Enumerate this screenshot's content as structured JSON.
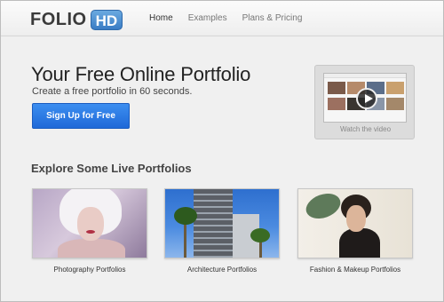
{
  "brand": {
    "name": "FOLIO",
    "badge": "HD"
  },
  "nav": [
    {
      "label": "Home",
      "active": true
    },
    {
      "label": "Examples",
      "active": false
    },
    {
      "label": "Plans & Pricing",
      "active": false
    }
  ],
  "hero": {
    "title": "Your Free Online Portfolio",
    "subtitle": "Create a free portfolio in 60 seconds.",
    "cta_label": "Sign Up for Free"
  },
  "video": {
    "caption": "Watch the video"
  },
  "explore": {
    "title": "Explore Some Live Portfolios",
    "cards": [
      {
        "caption": "Photography Portfolios"
      },
      {
        "caption": "Architecture Portfolios"
      },
      {
        "caption": "Fashion & Makeup Portfolios"
      }
    ]
  },
  "colors": {
    "accent": "#2a78e4",
    "badge": "#4a8fd3",
    "background": "#f0f0f0"
  }
}
